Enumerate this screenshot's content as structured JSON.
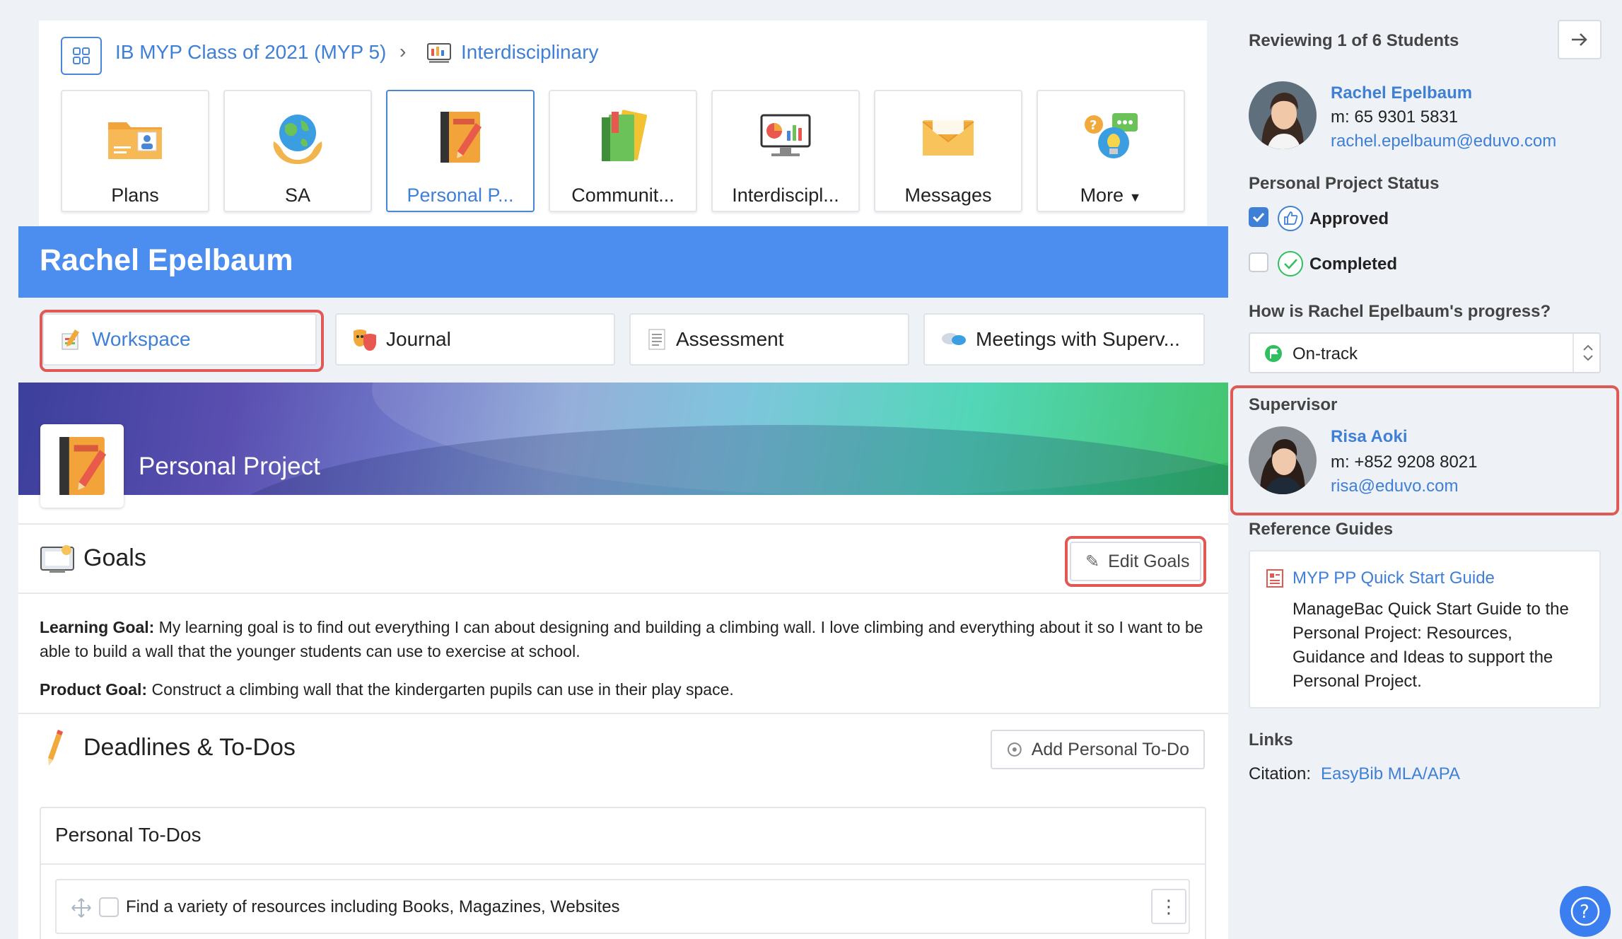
{
  "breadcrumb": {
    "class": "IB MYP Class of 2021 (MYP 5)",
    "separator": "›",
    "section": "Interdisciplinary"
  },
  "tiles": [
    {
      "label": "Plans",
      "icon": "folder-plans-icon"
    },
    {
      "label": "SA",
      "icon": "globe-hands-icon"
    },
    {
      "label": "Personal P...",
      "icon": "notebook-pencil-icon",
      "active": true
    },
    {
      "label": "Communit...",
      "icon": "books-icon"
    },
    {
      "label": "Interdiscipl...",
      "icon": "monitor-chart-icon"
    },
    {
      "label": "Messages",
      "icon": "envelope-icon"
    },
    {
      "label": "More",
      "icon": "lightbulb-chat-icon",
      "dropdown": true
    }
  ],
  "student": {
    "name": "Rachel Epelbaum"
  },
  "subtabs": [
    {
      "label": "Workspace",
      "active": true
    },
    {
      "label": "Journal"
    },
    {
      "label": "Assessment"
    },
    {
      "label": "Meetings with Superv..."
    }
  ],
  "project": {
    "title": "Personal Project"
  },
  "goals": {
    "title": "Goals",
    "edit_label": "Edit Goals",
    "learning_label": "Learning Goal:",
    "learning_text": " My learning goal is to find out everything I can about designing and building a climbing wall. I love climbing and everything about it so I want to be able to build a wall that the younger students can use to exercise at school.",
    "product_label": "Product Goal:",
    "product_text": " Construct a climbing wall that the kindergarten pupils can use in their play space."
  },
  "deadlines": {
    "title": "Deadlines & To-Dos",
    "add_label": "Add Personal To-Do",
    "list_title": "Personal To-Dos",
    "items": [
      {
        "text": "Find a variety of resources including Books, Magazines, Websites"
      }
    ]
  },
  "sidebar": {
    "reviewing": "Reviewing 1 of 6 Students",
    "student_name": "Rachel Epelbaum",
    "student_phone": "m: 65 9301 5831",
    "student_email": "rachel.epelbaum@eduvo.com",
    "status_title": "Personal Project Status",
    "status_approved": "Approved",
    "status_completed": "Completed",
    "progress_question": "How is Rachel Epelbaum's progress?",
    "progress_value": "On-track",
    "supervisor_title": "Supervisor",
    "supervisor_name": "Risa Aoki",
    "supervisor_phone": "m: +852 9208 8021",
    "supervisor_email": "risa@eduvo.com",
    "ref_title": "Reference Guides",
    "ref_link": "MYP PP Quick Start Guide",
    "ref_desc_1": "ManageBac Quick Start Guide to the",
    "ref_desc_2": "Personal Project: Resources,",
    "ref_desc_3": "Guidance and Ideas to support the",
    "ref_desc_4": "Personal Project.",
    "links_title": "Links",
    "citation_label": "Citation:",
    "citation_link": "EasyBib MLA/APA"
  },
  "colors": {
    "accent": "#3f7fd6",
    "banner": "#4c8df0",
    "highlight": "#e05a55",
    "status_green": "#2fbf5e"
  }
}
